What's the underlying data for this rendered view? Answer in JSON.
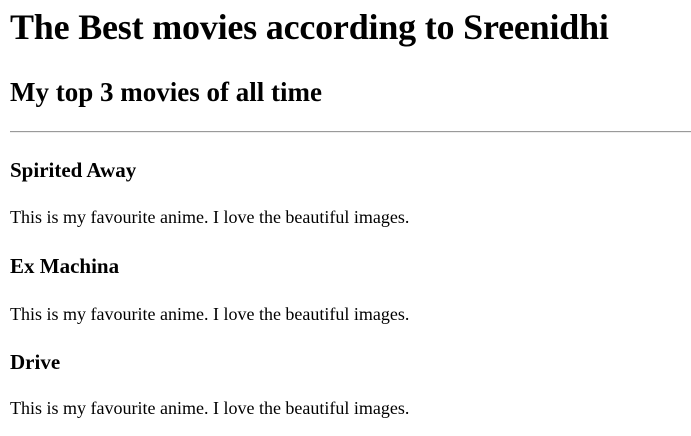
{
  "page": {
    "heading": "The Best movies according to Sreenidhi",
    "subheading": "My top 3 movies of all time"
  },
  "movies": [
    {
      "title": "Spirited Away",
      "description": "This is my favourite anime. I love the beautiful images."
    },
    {
      "title": "Ex Machina",
      "description": "This is my favourite anime. I love the beautiful images."
    },
    {
      "title": "Drive",
      "description": "This is my favourite anime. I love the beautiful images."
    }
  ]
}
